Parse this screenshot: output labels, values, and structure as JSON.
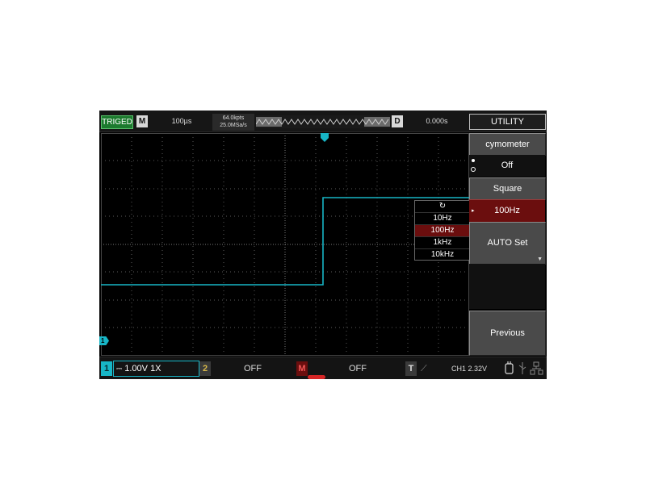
{
  "topbar": {
    "trigger_status": "TRIGED",
    "mode_label": "M",
    "timebase": "100µs",
    "memory_depth": "64.0kpts",
    "sample_rate": "25.0MSa/s",
    "delay_label": "D",
    "horizontal_position": "0.000s",
    "menu_title": "UTILITY"
  },
  "menu": {
    "cymometer_label": "cymometer",
    "cymometer_value": "Off",
    "waveform_label": "Square",
    "frequency_value": "100Hz",
    "auto_set_label": "AUTO Set",
    "previous_label": "Previous"
  },
  "frequency_popup": {
    "options": [
      "10Hz",
      "100Hz",
      "1kHz",
      "10kHz"
    ],
    "selected": "100Hz"
  },
  "bottombar": {
    "ch1_number": "1",
    "ch1_scale": "1.00V",
    "ch1_probe": "1X",
    "ch2_number": "2",
    "ch2_status": "OFF",
    "math_label": "M",
    "math_status": "OFF",
    "trigger_label": "T",
    "trigger_level": "CH1 2.32V"
  },
  "markers": {
    "ch1_marker": "1",
    "trigger_position_marker": "T"
  },
  "colors": {
    "ch1": "#17b5c6",
    "ch2": "#d8b84a",
    "math": "#d62626",
    "selected": "#6b0e0e",
    "triged": "#1c7a2e"
  }
}
